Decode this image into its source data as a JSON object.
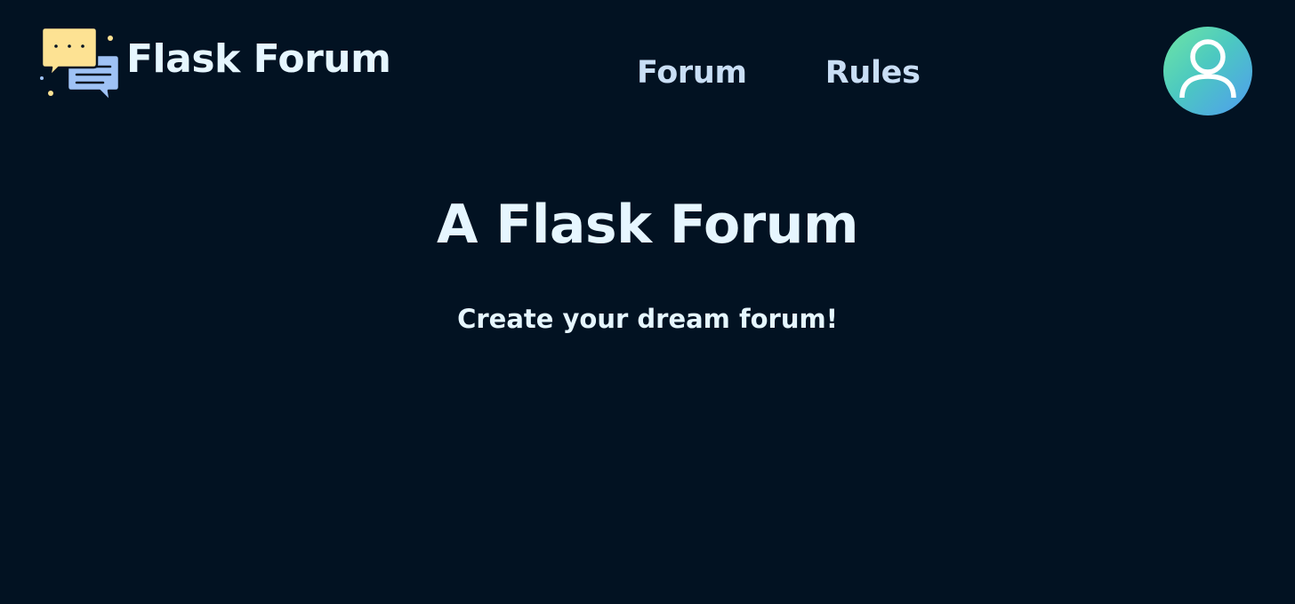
{
  "navbar": {
    "brand_title": "Flask Forum",
    "brand_icon": "chat-bubbles-icon",
    "links": [
      {
        "label": "Forum"
      },
      {
        "label": "Rules"
      }
    ],
    "avatar_icon": "user-icon"
  },
  "hero": {
    "title": "A Flask Forum",
    "subtitle": "Create your dream forum!"
  },
  "colors": {
    "background": "#021222",
    "text": "#e6f6ff",
    "nav_link": "#c9def5",
    "avatar_gradient_start": "#6fe6a3",
    "avatar_gradient_end": "#4f9cf0",
    "logo_yellow": "#fde293",
    "logo_blue": "#9fc2f5"
  }
}
